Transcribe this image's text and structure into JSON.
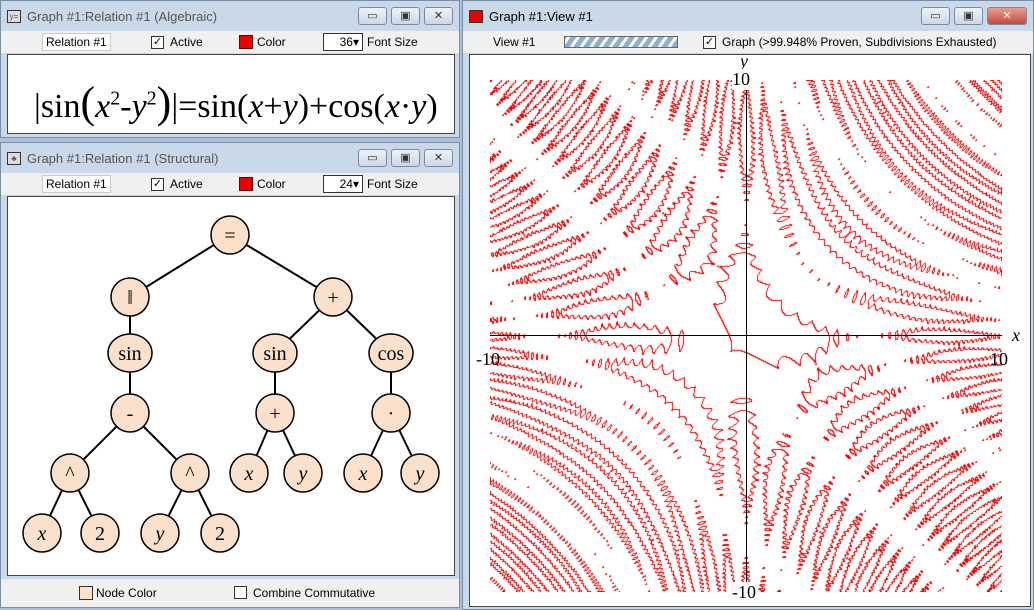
{
  "algebraic": {
    "title": "Graph #1:Relation #1 (Algebraic)",
    "icon": "y=",
    "relation": "Relation #1",
    "active_label": "Active",
    "active": true,
    "color_label": "Color",
    "color": "#ee0000",
    "font_size": "36",
    "font_size_label": "Font Size",
    "formula": {
      "abs_open": "|",
      "sin": "sin",
      "x": "x",
      "sup2a": "2",
      "minus": "-",
      "y": "y",
      "sup2b": "2",
      "abs_close": "|",
      "rhs": "=sin(",
      "x2": "x",
      "plus": "+",
      "y2": "y",
      "mid": ")+cos(",
      "x3": "x",
      "dot": "·",
      "y3": "y",
      "end": ")"
    }
  },
  "structural": {
    "title": "Graph #1:Relation #1 (Structural)",
    "relation": "Relation #1",
    "active_label": "Active",
    "active": true,
    "color_label": "Color",
    "font_size": "24",
    "font_size_label": "Font Size",
    "nodes": [
      "=",
      "‖",
      "+",
      "sin",
      "sin",
      "cos",
      "-",
      "+",
      "·",
      "^",
      "^",
      "x",
      "y",
      "x",
      "y",
      "x",
      "2",
      "y",
      "2"
    ],
    "node_color_label": "Node Color",
    "node_color": "#fbe0cc",
    "combine_label": "Combine Commutative",
    "combine": false
  },
  "view": {
    "title": "Graph #1:View #1",
    "view_name": "View #1",
    "graph_label": "Graph (>99.948% Proven, Subdivisions Exhausted)",
    "graph_checked": true,
    "x_axis": "x",
    "y_axis": "y",
    "xmin": "-10",
    "xmax": "10",
    "ymin": "-10",
    "ymax": "10",
    "curve_color": "#ee0000"
  },
  "buttons": {
    "min": "▭",
    "max": "▣",
    "close": "✕"
  }
}
